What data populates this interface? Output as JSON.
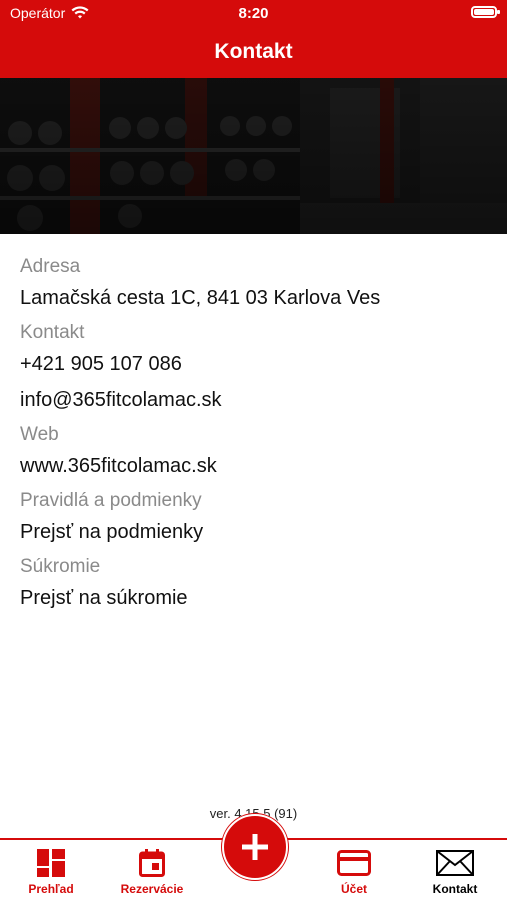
{
  "status_bar": {
    "carrier": "Operátor",
    "time": "8:20"
  },
  "header": {
    "title": "Kontakt"
  },
  "sections": [
    {
      "label": "Adresa",
      "values": [
        "Lamačská cesta 1C, 841 03 Karlova Ves"
      ]
    },
    {
      "label": "Kontakt",
      "values": [
        "+421 905 107 086",
        "info@365fitcolamac.sk"
      ]
    },
    {
      "label": "Web",
      "values": [
        "www.365fitcolamac.sk"
      ]
    },
    {
      "label": "Pravidlá a podmienky",
      "values": [
        "Prejsť na podmienky"
      ]
    },
    {
      "label": "Súkromie",
      "values": [
        "Prejsť na súkromie"
      ]
    }
  ],
  "version": "ver. 4.15.5 (91)",
  "tabbar": {
    "items": [
      {
        "label": "Prehľad",
        "icon": "dashboard-icon"
      },
      {
        "label": "Rezervácie",
        "icon": "calendar-icon"
      },
      {
        "label": "",
        "icon": "plus-icon"
      },
      {
        "label": "Účet",
        "icon": "card-icon"
      },
      {
        "label": "Kontakt",
        "icon": "envelope-icon"
      }
    ],
    "active": "Kontakt"
  },
  "colors": {
    "accent": "#d50b0b",
    "label_gray": "#8a8a8a"
  }
}
